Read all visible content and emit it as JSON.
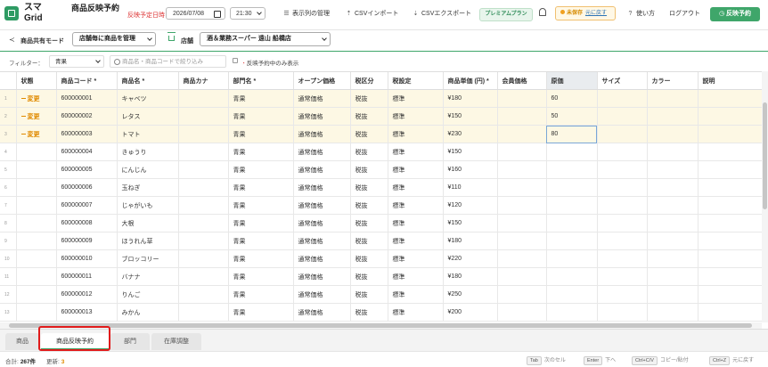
{
  "header": {
    "brand_line1": "スマ",
    "brand_line2": "Grid",
    "page_title": "商品反映予約",
    "schedule_label": "反映予定日時",
    "date_value": "2026/07/08",
    "time_value": "21:30",
    "manage_label": "表示列の管理",
    "csv_import_label": "CSVインポート",
    "csv_export_label": "CSVエクスポート",
    "premium_label": "プレミアムプラン",
    "unsaved_label": "未保存",
    "undo_label": "元に戻す",
    "help_label": "使い方",
    "logout_label": "ログアウト",
    "reserve_button_label": "反映予約"
  },
  "toolbar": {
    "share_mode_label": "商品共有モード",
    "share_mode_value": "店舗毎に商品を管理",
    "store_label": "店舗",
    "store_value": "酒＆業務スーパー 遠山 船橋店"
  },
  "filter": {
    "label": "フィルター：",
    "category_value": "青果",
    "search_placeholder": "商品名・商品コードで絞り込み",
    "only_reserved_label": "反映予約中のみ表示"
  },
  "grid": {
    "columns": [
      "状態",
      "商品コード *",
      "商品名 *",
      "商品カナ",
      "部門名 *",
      "オープン価格",
      "税区分",
      "税設定",
      "商品単価 (円) *",
      "会員価格",
      "原価",
      "サイズ",
      "カラー",
      "説明"
    ],
    "rows": [
      {
        "n": "1",
        "status": "変更",
        "code": "600000001",
        "name": "キャベツ",
        "kana": "",
        "dept": "青果",
        "open": "通常価格",
        "taxcat": "税抜",
        "taxset": "標準",
        "price": "¥180",
        "member": "",
        "cost": "60",
        "size": "",
        "color": "",
        "desc": ""
      },
      {
        "n": "2",
        "status": "変更",
        "code": "600000002",
        "name": "レタス",
        "kana": "",
        "dept": "青果",
        "open": "通常価格",
        "taxcat": "税抜",
        "taxset": "標準",
        "price": "¥150",
        "member": "",
        "cost": "50",
        "size": "",
        "color": "",
        "desc": ""
      },
      {
        "n": "3",
        "status": "変更",
        "code": "600000003",
        "name": "トマト",
        "kana": "",
        "dept": "青果",
        "open": "通常価格",
        "taxcat": "税抜",
        "taxset": "標準",
        "price": "¥230",
        "member": "",
        "cost": "80",
        "size": "",
        "color": "",
        "desc": ""
      },
      {
        "n": "4",
        "status": "",
        "code": "600000004",
        "name": "きゅうり",
        "kana": "",
        "dept": "青果",
        "open": "通常価格",
        "taxcat": "税抜",
        "taxset": "標準",
        "price": "¥150",
        "member": "",
        "cost": "",
        "size": "",
        "color": "",
        "desc": ""
      },
      {
        "n": "5",
        "status": "",
        "code": "600000005",
        "name": "にんじん",
        "kana": "",
        "dept": "青果",
        "open": "通常価格",
        "taxcat": "税抜",
        "taxset": "標準",
        "price": "¥160",
        "member": "",
        "cost": "",
        "size": "",
        "color": "",
        "desc": ""
      },
      {
        "n": "6",
        "status": "",
        "code": "600000006",
        "name": "玉ねぎ",
        "kana": "",
        "dept": "青果",
        "open": "通常価格",
        "taxcat": "税抜",
        "taxset": "標準",
        "price": "¥110",
        "member": "",
        "cost": "",
        "size": "",
        "color": "",
        "desc": ""
      },
      {
        "n": "7",
        "status": "",
        "code": "600000007",
        "name": "じゃがいも",
        "kana": "",
        "dept": "青果",
        "open": "通常価格",
        "taxcat": "税抜",
        "taxset": "標準",
        "price": "¥120",
        "member": "",
        "cost": "",
        "size": "",
        "color": "",
        "desc": ""
      },
      {
        "n": "8",
        "status": "",
        "code": "600000008",
        "name": "大根",
        "kana": "",
        "dept": "青果",
        "open": "通常価格",
        "taxcat": "税抜",
        "taxset": "標準",
        "price": "¥150",
        "member": "",
        "cost": "",
        "size": "",
        "color": "",
        "desc": ""
      },
      {
        "n": "9",
        "status": "",
        "code": "600000009",
        "name": "ほうれん草",
        "kana": "",
        "dept": "青果",
        "open": "通常価格",
        "taxcat": "税抜",
        "taxset": "標準",
        "price": "¥180",
        "member": "",
        "cost": "",
        "size": "",
        "color": "",
        "desc": ""
      },
      {
        "n": "10",
        "status": "",
        "code": "600000010",
        "name": "ブロッコリー",
        "kana": "",
        "dept": "青果",
        "open": "通常価格",
        "taxcat": "税抜",
        "taxset": "標準",
        "price": "¥220",
        "member": "",
        "cost": "",
        "size": "",
        "color": "",
        "desc": ""
      },
      {
        "n": "11",
        "status": "",
        "code": "600000011",
        "name": "バナナ",
        "kana": "",
        "dept": "青果",
        "open": "通常価格",
        "taxcat": "税抜",
        "taxset": "標準",
        "price": "¥180",
        "member": "",
        "cost": "",
        "size": "",
        "color": "",
        "desc": ""
      },
      {
        "n": "12",
        "status": "",
        "code": "600000012",
        "name": "りんご",
        "kana": "",
        "dept": "青果",
        "open": "通常価格",
        "taxcat": "税抜",
        "taxset": "標準",
        "price": "¥250",
        "member": "",
        "cost": "",
        "size": "",
        "color": "",
        "desc": ""
      },
      {
        "n": "13",
        "status": "",
        "code": "600000013",
        "name": "みかん",
        "kana": "",
        "dept": "青果",
        "open": "通常価格",
        "taxcat": "税抜",
        "taxset": "標準",
        "price": "¥200",
        "member": "",
        "cost": "",
        "size": "",
        "color": "",
        "desc": ""
      }
    ]
  },
  "tabs": [
    "商品",
    "商品反映予約",
    "部門",
    "在庫調整"
  ],
  "status_bar": {
    "total_label": "合計:",
    "total_value": "267件",
    "updated_label": "更新:",
    "updated_value": "3",
    "hints": [
      {
        "key": "Tab",
        "text": "次のセル"
      },
      {
        "key": "Enter",
        "text": "下へ"
      },
      {
        "key": "Ctrl+C/V",
        "text": "コピー/貼付"
      },
      {
        "key": "Ctrl+Z",
        "text": "元に戻す"
      }
    ]
  },
  "colors": {
    "accent": "#3fa66a",
    "changed_row": "#fdf8e4",
    "status_text": "#e08a00",
    "highlight": "#e01b1b"
  }
}
